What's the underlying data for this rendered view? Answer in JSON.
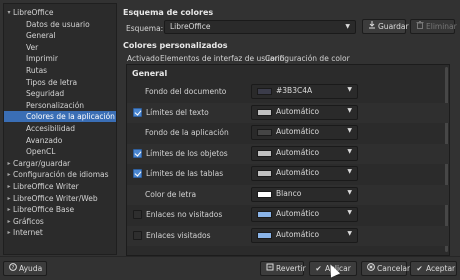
{
  "tree": {
    "items": [
      {
        "label": "LibreOffice",
        "arrow": "▾",
        "indent": 0
      },
      {
        "label": "Datos de usuario",
        "arrow": "",
        "indent": 1
      },
      {
        "label": "General",
        "arrow": "",
        "indent": 1
      },
      {
        "label": "Ver",
        "arrow": "",
        "indent": 1
      },
      {
        "label": "Imprimir",
        "arrow": "",
        "indent": 1
      },
      {
        "label": "Rutas",
        "arrow": "",
        "indent": 1
      },
      {
        "label": "Tipos de letra",
        "arrow": "",
        "indent": 1
      },
      {
        "label": "Seguridad",
        "arrow": "",
        "indent": 1
      },
      {
        "label": "Personalización",
        "arrow": "",
        "indent": 1
      },
      {
        "label": "Colores de la aplicación",
        "arrow": "",
        "indent": 1,
        "selected": true
      },
      {
        "label": "Accesibilidad",
        "arrow": "",
        "indent": 1
      },
      {
        "label": "Avanzado",
        "arrow": "",
        "indent": 1
      },
      {
        "label": "OpenCL",
        "arrow": "",
        "indent": 1
      },
      {
        "label": "Cargar/guardar",
        "arrow": "▸",
        "indent": 0
      },
      {
        "label": "Configuración de idiomas",
        "arrow": "▸",
        "indent": 0
      },
      {
        "label": "LibreOffice Writer",
        "arrow": "▸",
        "indent": 0
      },
      {
        "label": "LibreOffice Writer/Web",
        "arrow": "▸",
        "indent": 0
      },
      {
        "label": "LibreOffice Base",
        "arrow": "▸",
        "indent": 0
      },
      {
        "label": "Gráficos",
        "arrow": "▸",
        "indent": 0
      },
      {
        "label": "Internet",
        "arrow": "▸",
        "indent": 0
      }
    ]
  },
  "scheme": {
    "title": "Esquema de colores",
    "label": "Esquema:",
    "value": "LibreOffice",
    "save_label": "Guardar",
    "delete_label": "Eliminar"
  },
  "custom": {
    "title": "Colores personalizados",
    "col_active": "Activado",
    "col_element": "Elementos de interfaz de usuario",
    "col_color": "Configuración de color",
    "group": "General"
  },
  "rows": [
    {
      "label": "Fondo del documento",
      "checkbox": false,
      "checked": false,
      "value": "#3B3C4A",
      "color": "#3b3c4a"
    },
    {
      "label": "Límites del texto",
      "checkbox": true,
      "checked": true,
      "value": "Automático",
      "color": "#c0c0c0"
    },
    {
      "label": "Fondo de la aplicación",
      "checkbox": false,
      "checked": false,
      "value": "Automático",
      "color": "#454545"
    },
    {
      "label": "Límites de los objetos",
      "checkbox": true,
      "checked": true,
      "value": "Automático",
      "color": "#c0c0c0"
    },
    {
      "label": "Límites de las tablas",
      "checkbox": true,
      "checked": true,
      "value": "Automático",
      "color": "#c0c0c0"
    },
    {
      "label": "Color de letra",
      "checkbox": false,
      "checked": false,
      "value": "Blanco",
      "color": "#ffffff"
    },
    {
      "label": "Enlaces no visitados",
      "checkbox": true,
      "checked": false,
      "value": "Automático",
      "color": "#8ab4e8"
    },
    {
      "label": "Enlaces visitados",
      "checkbox": true,
      "checked": false,
      "value": "Automático",
      "color": "#8ab4e8"
    }
  ],
  "buttons": {
    "help": "Ayuda",
    "revert": "Revertir",
    "apply": "Aplicar",
    "cancel": "Cancelar",
    "accept": "Aceptar"
  },
  "icons": {
    "help": "help-circle-icon",
    "revert": "revert-icon",
    "apply": "checkmark-icon",
    "cancel": "cancel-icon",
    "accept": "checkmark-icon",
    "save": "save-icon",
    "delete": "delete-icon"
  }
}
